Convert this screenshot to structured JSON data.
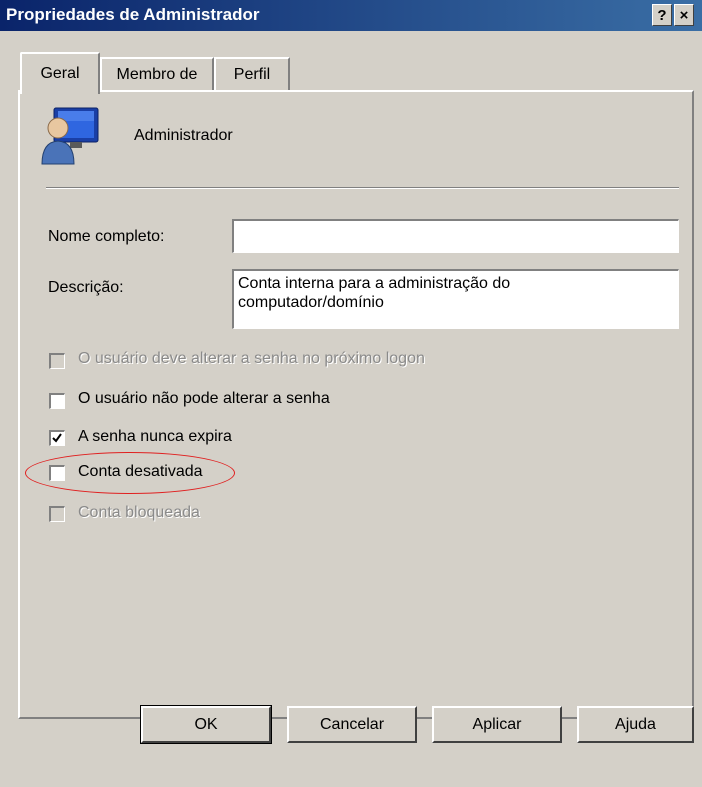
{
  "window": {
    "title": "Propriedades de Administrador",
    "help_label": "?",
    "close_label": "×"
  },
  "tabs": [
    {
      "label": "Geral",
      "active": true
    },
    {
      "label": "Membro de",
      "active": false
    },
    {
      "label": "Perfil",
      "active": false
    }
  ],
  "user": {
    "name": "Administrador",
    "icon": "user-monitor-icon"
  },
  "form": {
    "fullname_label": "Nome completo:",
    "fullname_value": "",
    "description_label": "Descrição:",
    "description_line1": "Conta interna para a administração do",
    "description_line2": "computador/domínio"
  },
  "checkboxes": [
    {
      "label": "O usuário deve alterar a senha no próximo logon",
      "checked": false,
      "disabled": true
    },
    {
      "label": "O usuário não pode alterar a senha",
      "checked": false,
      "disabled": false
    },
    {
      "label": "A senha nunca expira",
      "checked": true,
      "disabled": false
    },
    {
      "label": "Conta desativada",
      "checked": false,
      "disabled": false
    },
    {
      "label": "Conta bloqueada",
      "checked": false,
      "disabled": true
    }
  ],
  "annotation_color": "#e02020",
  "buttons": {
    "ok": "OK",
    "cancel": "Cancelar",
    "apply": "Aplicar",
    "help": "Ajuda"
  }
}
